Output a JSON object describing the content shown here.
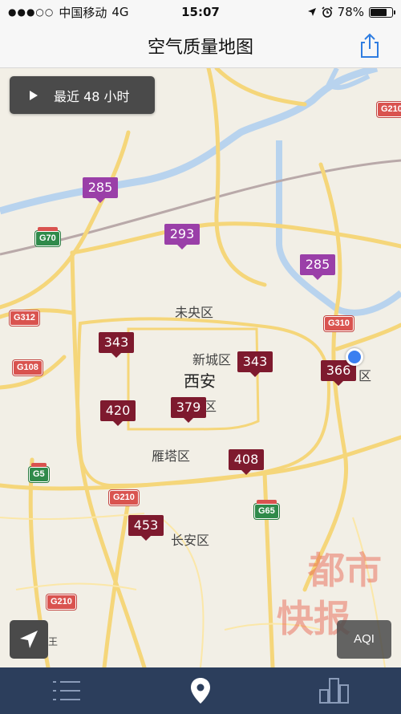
{
  "status_bar": {
    "carrier": "中国移动",
    "network": "4G",
    "time": "15:07",
    "battery": "78%",
    "battery_level": 0.78
  },
  "nav": {
    "title": "空气质量地图",
    "share_icon": "share-icon"
  },
  "time_button": {
    "label": "最近 48 小时",
    "icon": "play-icon"
  },
  "aqi_button": {
    "label": "AQI"
  },
  "map": {
    "places": {
      "xian": "西安",
      "weiyang": "未央区",
      "xincheng": "新城区",
      "beilin": "碑林区",
      "yanta": "雁塔区",
      "changan": "长安区",
      "baqiao_suffix": "区",
      "partial_label": "王"
    },
    "markers": [
      {
        "value": "285",
        "level": "purple"
      },
      {
        "value": "293",
        "level": "purple"
      },
      {
        "value": "285",
        "level": "purple"
      },
      {
        "value": "343",
        "level": "maroon"
      },
      {
        "value": "343",
        "level": "maroon"
      },
      {
        "value": "366",
        "level": "maroon"
      },
      {
        "value": "420",
        "level": "maroon"
      },
      {
        "value": "379",
        "level": "maroon"
      },
      {
        "value": "408",
        "level": "maroon"
      },
      {
        "value": "453",
        "level": "maroon"
      }
    ],
    "shields": [
      "G210",
      "G70",
      "G312",
      "G310",
      "G108",
      "G5",
      "G210",
      "G65",
      "G210"
    ],
    "colors": {
      "purple": "#9a3fa8",
      "maroon": "#7e1a2e",
      "road": "#f5d67a",
      "water": "#b8d3ee",
      "tab_bar": "#2c3e5c"
    }
  },
  "watermark": {
    "line1": "都市",
    "line2": "快报"
  },
  "tabs": [
    {
      "name": "list",
      "icon": "list-icon"
    },
    {
      "name": "map",
      "icon": "map-pin-icon"
    },
    {
      "name": "ranking",
      "icon": "bar-chart-icon"
    }
  ]
}
